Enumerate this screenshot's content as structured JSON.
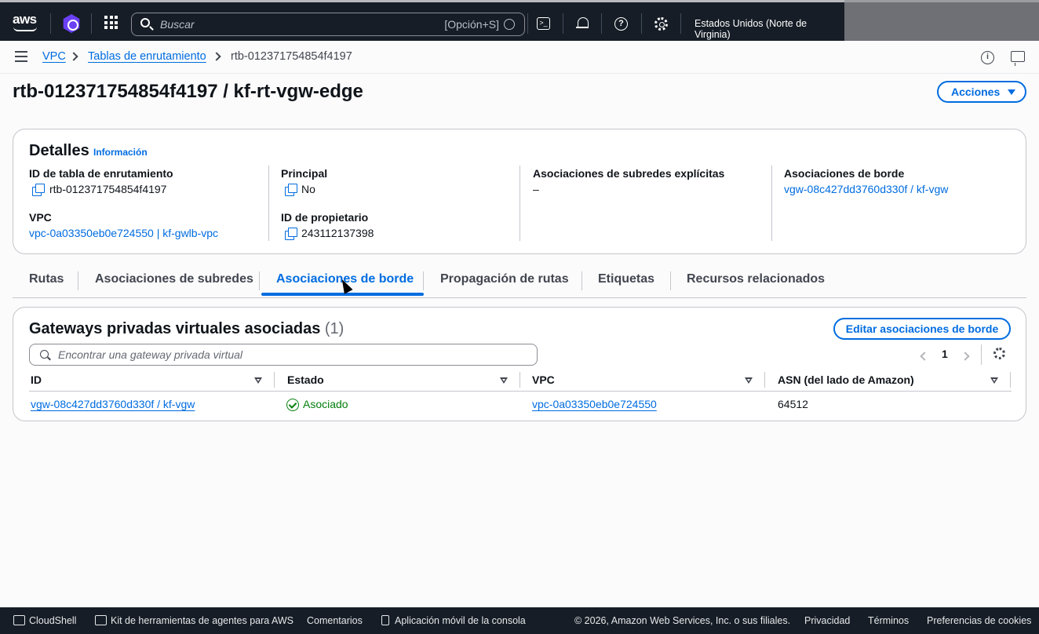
{
  "topnav": {
    "logo": "aws",
    "search_placeholder": "Buscar",
    "search_shortcut": "[Opción+S]",
    "region": "Estados Unidos (Norte de Virginia)"
  },
  "breadcrumb": [
    "VPC",
    "Tablas de enrutamiento",
    "rtb-012371754854f4197"
  ],
  "page": {
    "title": "rtb-012371754854f4197 / kf-rt-vgw-edge",
    "actions_label": "Acciones"
  },
  "details": {
    "title": "Detalles",
    "info_label": "Información",
    "fields": {
      "rt_id_label": "ID de tabla de enrutamiento",
      "rt_id_value": "rtb-012371754854f4197",
      "vpc_label": "VPC",
      "vpc_value": "vpc-0a03350eb0e724550 | kf-gwlb-vpc",
      "main_label": "Principal",
      "main_value": "No",
      "owner_label": "ID de propietario",
      "owner_value": "243112137398",
      "subnet_assoc_label": "Asociaciones de subredes explícitas",
      "subnet_assoc_value": "–",
      "edge_assoc_label": "Asociaciones de borde",
      "edge_assoc_value": "vgw-08c427dd3760d330f / kf-vgw"
    }
  },
  "tabs": [
    "Rutas",
    "Asociaciones de subredes",
    "Asociaciones de borde",
    "Propagación de rutas",
    "Etiquetas",
    "Recursos relacionados"
  ],
  "active_tab": "Asociaciones de borde",
  "gateways": {
    "title": "Gateways privadas virtuales asociadas",
    "count": "(1)",
    "edit_label": "Editar asociaciones de borde",
    "filter_placeholder": "Encontrar una gateway privada virtual",
    "page_number": "1",
    "columns": [
      "ID",
      "Estado",
      "VPC",
      "ASN (del lado de Amazon)"
    ],
    "rows": [
      {
        "id": "vgw-08c427dd3760d330f / kf-vgw",
        "status": "Asociado",
        "vpc": "vpc-0a03350eb0e724550",
        "asn": "64512"
      }
    ]
  },
  "footer": {
    "cloudshell": "CloudShell",
    "toolkit": "Kit de herramientas de agentes para AWS",
    "feedback": "Comentarios",
    "mobile": "Aplicación móvil de la consola",
    "copyright": "© 2026, Amazon Web Services, Inc. o sus filiales.",
    "privacy": "Privacidad",
    "terms": "Términos",
    "cookies": "Preferencias de cookies"
  },
  "colors": {
    "accent": "#006ce0",
    "nav_bg": "#161d26",
    "success": "#037f0c"
  }
}
